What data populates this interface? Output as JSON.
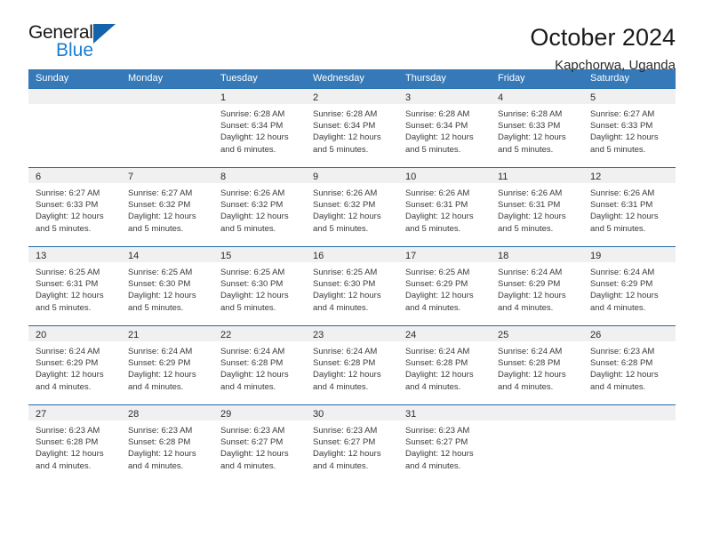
{
  "brand": {
    "name_top": "General",
    "name_bottom": "Blue",
    "accent": "#1a7fd4",
    "triangle": "#1464aa"
  },
  "header": {
    "title": "October 2024",
    "subtitle": "Kapchorwa, Uganda"
  },
  "calendar": {
    "header_bg": "#3579b8",
    "weekdays": [
      "Sunday",
      "Monday",
      "Tuesday",
      "Wednesday",
      "Thursday",
      "Friday",
      "Saturday"
    ],
    "weeks": [
      [
        {
          "day": "",
          "sunrise": "",
          "sunset": "",
          "daylight1": "",
          "daylight2": ""
        },
        {
          "day": "",
          "sunrise": "",
          "sunset": "",
          "daylight1": "",
          "daylight2": ""
        },
        {
          "day": "1",
          "sunrise": "Sunrise: 6:28 AM",
          "sunset": "Sunset: 6:34 PM",
          "daylight1": "Daylight: 12 hours",
          "daylight2": "and 6 minutes."
        },
        {
          "day": "2",
          "sunrise": "Sunrise: 6:28 AM",
          "sunset": "Sunset: 6:34 PM",
          "daylight1": "Daylight: 12 hours",
          "daylight2": "and 5 minutes."
        },
        {
          "day": "3",
          "sunrise": "Sunrise: 6:28 AM",
          "sunset": "Sunset: 6:34 PM",
          "daylight1": "Daylight: 12 hours",
          "daylight2": "and 5 minutes."
        },
        {
          "day": "4",
          "sunrise": "Sunrise: 6:28 AM",
          "sunset": "Sunset: 6:33 PM",
          "daylight1": "Daylight: 12 hours",
          "daylight2": "and 5 minutes."
        },
        {
          "day": "5",
          "sunrise": "Sunrise: 6:27 AM",
          "sunset": "Sunset: 6:33 PM",
          "daylight1": "Daylight: 12 hours",
          "daylight2": "and 5 minutes."
        }
      ],
      [
        {
          "day": "6",
          "sunrise": "Sunrise: 6:27 AM",
          "sunset": "Sunset: 6:33 PM",
          "daylight1": "Daylight: 12 hours",
          "daylight2": "and 5 minutes."
        },
        {
          "day": "7",
          "sunrise": "Sunrise: 6:27 AM",
          "sunset": "Sunset: 6:32 PM",
          "daylight1": "Daylight: 12 hours",
          "daylight2": "and 5 minutes."
        },
        {
          "day": "8",
          "sunrise": "Sunrise: 6:26 AM",
          "sunset": "Sunset: 6:32 PM",
          "daylight1": "Daylight: 12 hours",
          "daylight2": "and 5 minutes."
        },
        {
          "day": "9",
          "sunrise": "Sunrise: 6:26 AM",
          "sunset": "Sunset: 6:32 PM",
          "daylight1": "Daylight: 12 hours",
          "daylight2": "and 5 minutes."
        },
        {
          "day": "10",
          "sunrise": "Sunrise: 6:26 AM",
          "sunset": "Sunset: 6:31 PM",
          "daylight1": "Daylight: 12 hours",
          "daylight2": "and 5 minutes."
        },
        {
          "day": "11",
          "sunrise": "Sunrise: 6:26 AM",
          "sunset": "Sunset: 6:31 PM",
          "daylight1": "Daylight: 12 hours",
          "daylight2": "and 5 minutes."
        },
        {
          "day": "12",
          "sunrise": "Sunrise: 6:26 AM",
          "sunset": "Sunset: 6:31 PM",
          "daylight1": "Daylight: 12 hours",
          "daylight2": "and 5 minutes."
        }
      ],
      [
        {
          "day": "13",
          "sunrise": "Sunrise: 6:25 AM",
          "sunset": "Sunset: 6:31 PM",
          "daylight1": "Daylight: 12 hours",
          "daylight2": "and 5 minutes."
        },
        {
          "day": "14",
          "sunrise": "Sunrise: 6:25 AM",
          "sunset": "Sunset: 6:30 PM",
          "daylight1": "Daylight: 12 hours",
          "daylight2": "and 5 minutes."
        },
        {
          "day": "15",
          "sunrise": "Sunrise: 6:25 AM",
          "sunset": "Sunset: 6:30 PM",
          "daylight1": "Daylight: 12 hours",
          "daylight2": "and 5 minutes."
        },
        {
          "day": "16",
          "sunrise": "Sunrise: 6:25 AM",
          "sunset": "Sunset: 6:30 PM",
          "daylight1": "Daylight: 12 hours",
          "daylight2": "and 4 minutes."
        },
        {
          "day": "17",
          "sunrise": "Sunrise: 6:25 AM",
          "sunset": "Sunset: 6:29 PM",
          "daylight1": "Daylight: 12 hours",
          "daylight2": "and 4 minutes."
        },
        {
          "day": "18",
          "sunrise": "Sunrise: 6:24 AM",
          "sunset": "Sunset: 6:29 PM",
          "daylight1": "Daylight: 12 hours",
          "daylight2": "and 4 minutes."
        },
        {
          "day": "19",
          "sunrise": "Sunrise: 6:24 AM",
          "sunset": "Sunset: 6:29 PM",
          "daylight1": "Daylight: 12 hours",
          "daylight2": "and 4 minutes."
        }
      ],
      [
        {
          "day": "20",
          "sunrise": "Sunrise: 6:24 AM",
          "sunset": "Sunset: 6:29 PM",
          "daylight1": "Daylight: 12 hours",
          "daylight2": "and 4 minutes."
        },
        {
          "day": "21",
          "sunrise": "Sunrise: 6:24 AM",
          "sunset": "Sunset: 6:29 PM",
          "daylight1": "Daylight: 12 hours",
          "daylight2": "and 4 minutes."
        },
        {
          "day": "22",
          "sunrise": "Sunrise: 6:24 AM",
          "sunset": "Sunset: 6:28 PM",
          "daylight1": "Daylight: 12 hours",
          "daylight2": "and 4 minutes."
        },
        {
          "day": "23",
          "sunrise": "Sunrise: 6:24 AM",
          "sunset": "Sunset: 6:28 PM",
          "daylight1": "Daylight: 12 hours",
          "daylight2": "and 4 minutes."
        },
        {
          "day": "24",
          "sunrise": "Sunrise: 6:24 AM",
          "sunset": "Sunset: 6:28 PM",
          "daylight1": "Daylight: 12 hours",
          "daylight2": "and 4 minutes."
        },
        {
          "day": "25",
          "sunrise": "Sunrise: 6:24 AM",
          "sunset": "Sunset: 6:28 PM",
          "daylight1": "Daylight: 12 hours",
          "daylight2": "and 4 minutes."
        },
        {
          "day": "26",
          "sunrise": "Sunrise: 6:23 AM",
          "sunset": "Sunset: 6:28 PM",
          "daylight1": "Daylight: 12 hours",
          "daylight2": "and 4 minutes."
        }
      ],
      [
        {
          "day": "27",
          "sunrise": "Sunrise: 6:23 AM",
          "sunset": "Sunset: 6:28 PM",
          "daylight1": "Daylight: 12 hours",
          "daylight2": "and 4 minutes."
        },
        {
          "day": "28",
          "sunrise": "Sunrise: 6:23 AM",
          "sunset": "Sunset: 6:28 PM",
          "daylight1": "Daylight: 12 hours",
          "daylight2": "and 4 minutes."
        },
        {
          "day": "29",
          "sunrise": "Sunrise: 6:23 AM",
          "sunset": "Sunset: 6:27 PM",
          "daylight1": "Daylight: 12 hours",
          "daylight2": "and 4 minutes."
        },
        {
          "day": "30",
          "sunrise": "Sunrise: 6:23 AM",
          "sunset": "Sunset: 6:27 PM",
          "daylight1": "Daylight: 12 hours",
          "daylight2": "and 4 minutes."
        },
        {
          "day": "31",
          "sunrise": "Sunrise: 6:23 AM",
          "sunset": "Sunset: 6:27 PM",
          "daylight1": "Daylight: 12 hours",
          "daylight2": "and 4 minutes."
        },
        {
          "day": "",
          "sunrise": "",
          "sunset": "",
          "daylight1": "",
          "daylight2": ""
        },
        {
          "day": "",
          "sunrise": "",
          "sunset": "",
          "daylight1": "",
          "daylight2": ""
        }
      ]
    ]
  }
}
